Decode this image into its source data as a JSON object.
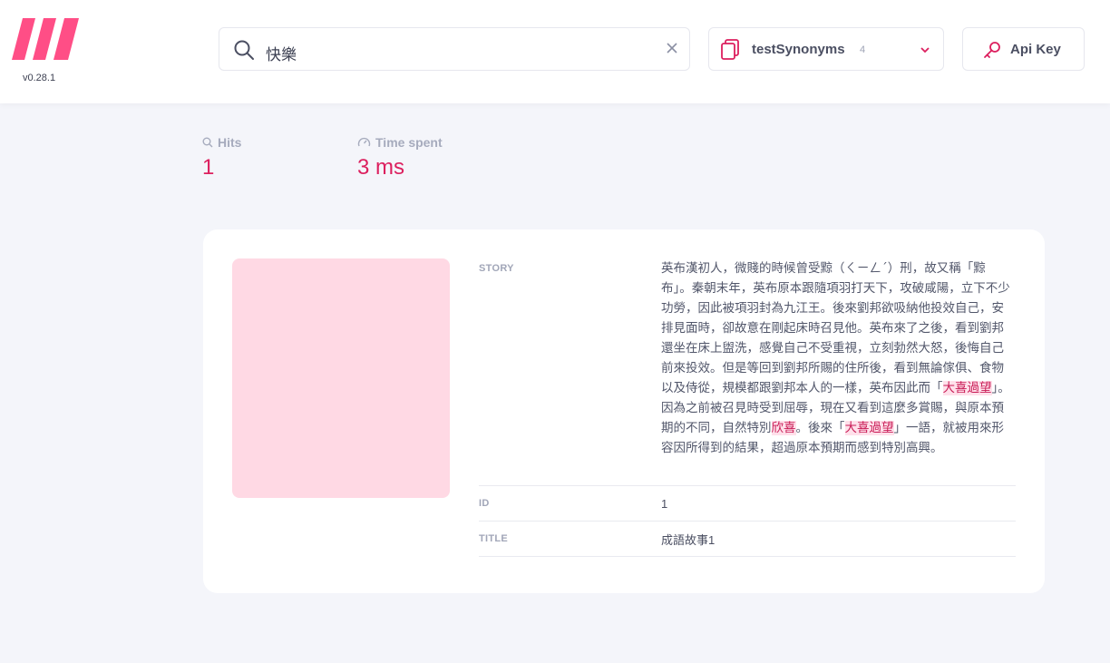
{
  "app": {
    "version": "v0.28.1",
    "brand_color": "#ff4e86"
  },
  "search": {
    "value": "快樂",
    "clear_icon": "close-icon"
  },
  "index_selector": {
    "name": "testSynonyms",
    "count": "4"
  },
  "api_key": {
    "label": "Api Key"
  },
  "stats": {
    "hits_label": "Hits",
    "hits_value": "1",
    "time_label": "Time spent",
    "time_value": "3 ms"
  },
  "result": {
    "story_key": "STORY",
    "story_parts": [
      "英布漢初人，微賤的時候曾受黥（ㄑㄧㄥˊ）刑，故又稱「黥布」。秦朝末年，英布原本跟隨項羽打天下，攻破咸陽，立下不少功勞，因此被項羽封為九江王。後來劉邦欲吸納他投效自己，安排見面時，卻故意在剛起床時召見他。英布來了之後，看到劉邦還坐在床上盥洗，感覺自己不受重視，立刻勃然大怒，後悔自己前來投效。但是等回到劉邦所賜的住所後，看到無論傢俱、食物以及侍從，規模都跟劉邦本人的一樣，英布因此而「",
      "大喜過望",
      "」。因為之前被召見時受到屈辱，現在又看到這麼多賞賜，與原本預期的不同，自然特別",
      "欣喜",
      "。後來「",
      "大喜過望",
      "」一語，就被用來形容因所得到的結果，超過原本預期而感到特別高興。"
    ],
    "id_key": "ID",
    "id_value": "1",
    "title_key": "TITLE",
    "title_value": "成語故事1"
  }
}
